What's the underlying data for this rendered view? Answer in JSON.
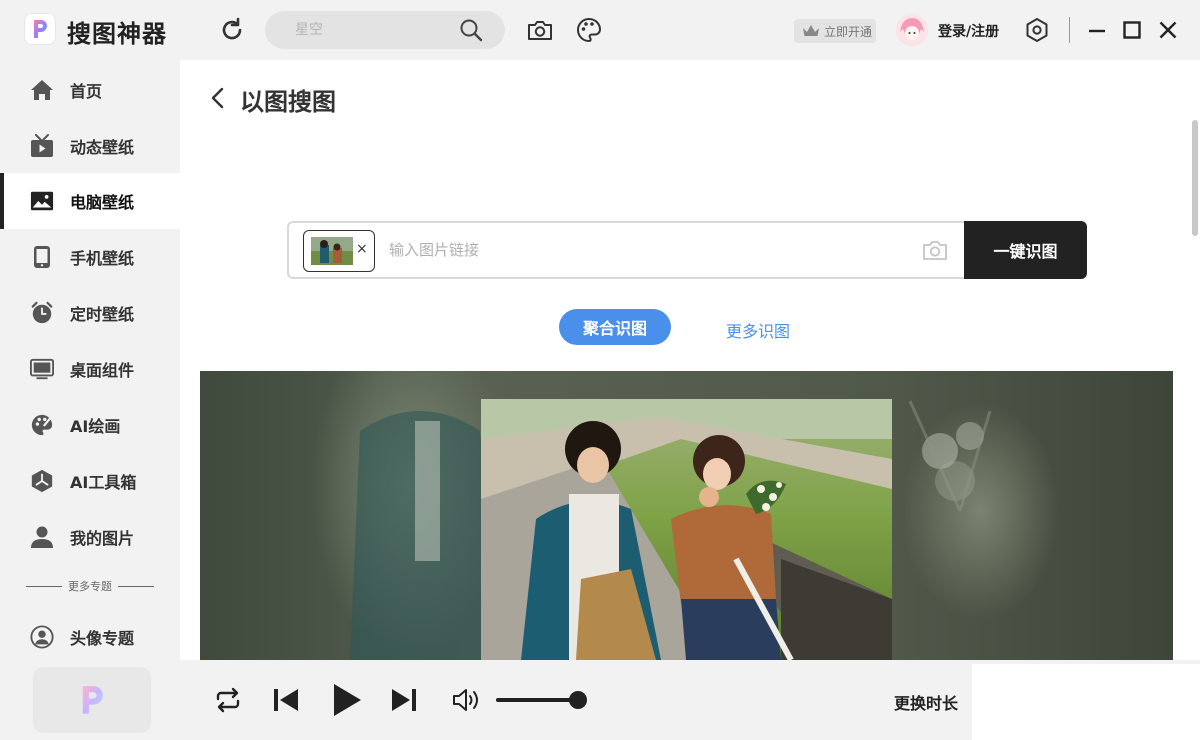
{
  "app": {
    "title": "搜图神器"
  },
  "header": {
    "search_placeholder": "星空",
    "vip_label": "立即开通",
    "login_label": "登录/注册"
  },
  "sidebar": {
    "items": [
      {
        "label": "首页",
        "icon": "home-icon"
      },
      {
        "label": "动态壁纸",
        "icon": "tv-icon"
      },
      {
        "label": "电脑壁纸",
        "icon": "image-icon",
        "active": true
      },
      {
        "label": "手机壁纸",
        "icon": "phone-icon"
      },
      {
        "label": "定时壁纸",
        "icon": "alarm-clock-icon"
      },
      {
        "label": "桌面组件",
        "icon": "monitor-icon"
      },
      {
        "label": "AI绘画",
        "icon": "palette-icon"
      },
      {
        "label": "AI工具箱",
        "icon": "cube-icon"
      },
      {
        "label": "我的图片",
        "icon": "user-icon"
      }
    ],
    "more_topics_label": "更多专题",
    "topic_items": [
      {
        "label": "头像专题",
        "icon": "avatar-icon"
      }
    ]
  },
  "main": {
    "page_title": "以图搜图",
    "url_placeholder": "输入图片链接",
    "remove_glyph": "×",
    "search_button": "一键识图",
    "tabs": [
      {
        "label": "聚合识图",
        "active": true
      },
      {
        "label": "更多识图",
        "active": false
      }
    ]
  },
  "player": {
    "change_duration_label": "更换时长",
    "volume": 0.95
  },
  "colors": {
    "accent": "#4a8fea",
    "dark": "#222222",
    "panel": "#f2f2f2"
  }
}
